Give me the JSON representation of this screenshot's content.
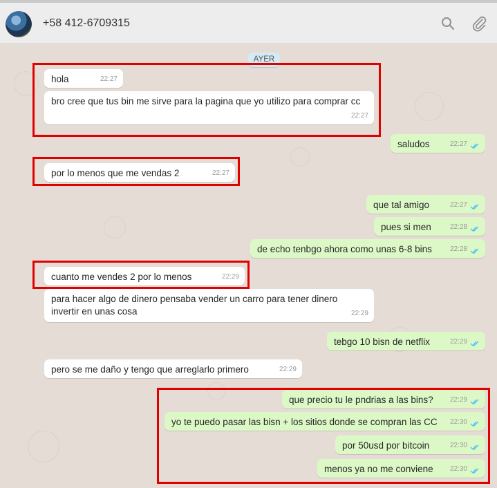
{
  "header": {
    "contact_name": "+58 412-6709315",
    "icons": [
      "search-icon",
      "attach-icon"
    ]
  },
  "date_label": "AYER",
  "messages": [
    {
      "text": "hola",
      "time": "22:27",
      "direction": "in"
    },
    {
      "text": "bro cree que tus bin me sirve para la pagina que yo utilizo para comprar cc",
      "time": "22:27",
      "direction": "in"
    },
    {
      "text": "saludos",
      "time": "22:27",
      "direction": "out"
    },
    {
      "text": "por lo menos que me vendas 2",
      "time": "22:27",
      "direction": "in"
    },
    {
      "text": "que tal amigo",
      "time": "22:27",
      "direction": "out"
    },
    {
      "text": "pues si men",
      "time": "22:28",
      "direction": "out"
    },
    {
      "text": "de echo tenbgo ahora como unas 6-8 bins",
      "time": "22:28",
      "direction": "out"
    },
    {
      "text": "cuanto me vendes 2 por lo menos",
      "time": "22:29",
      "direction": "in"
    },
    {
      "text": "para hacer algo de dinero pensaba vender un carro para tener dinero invertir en unas cosa",
      "time": "22:29",
      "direction": "in"
    },
    {
      "text": "tebgo 10 bisn de netflix",
      "time": "22:29",
      "direction": "out"
    },
    {
      "text": "pero se me daño y tengo que arreglarlo primero",
      "time": "22:29",
      "direction": "in"
    },
    {
      "text": "que precio tu le pndrias a las bins?",
      "time": "22:29",
      "direction": "out"
    },
    {
      "text": "yo te puedo pasar las bisn + los sitios donde se compran las CC",
      "time": "22:30",
      "direction": "out"
    },
    {
      "text": "por 50usd por bitcoin",
      "time": "22:30",
      "direction": "out"
    },
    {
      "text": "menos ya no me conviene",
      "time": "22:30",
      "direction": "out"
    }
  ],
  "colors": {
    "chat_background": "#e5ddd5",
    "outgoing_bubble": "#dcf8c6",
    "incoming_bubble": "#ffffff",
    "read_check": "#4fc3f7",
    "highlight_box": "#e00000"
  }
}
